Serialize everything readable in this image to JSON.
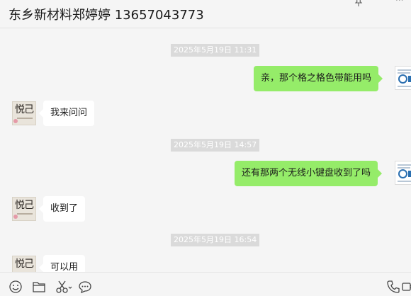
{
  "chat": {
    "title": "东乡新材料郑婷婷 13657043773"
  },
  "header_icons": {
    "pin": "pin-icon",
    "more": "more-icon"
  },
  "messages": [
    {
      "type": "time",
      "text": "2025年5月19日 11:31"
    },
    {
      "type": "sent",
      "text": "亲，那个格之格色带能用吗"
    },
    {
      "type": "received",
      "text": "我来问问"
    },
    {
      "type": "time",
      "text": "2025年5月19日 14:57"
    },
    {
      "type": "sent",
      "text": "还有那两个无线小键盘收到了吗"
    },
    {
      "type": "received",
      "text": "收到了"
    },
    {
      "type": "time",
      "text": "2025年5月19日 16:54"
    },
    {
      "type": "received",
      "text": "可以用"
    }
  ],
  "toolbar": {
    "icons": [
      "emoji-icon",
      "folder-icon",
      "scissors-icon",
      "chat-bubble-icon",
      "phone-icon",
      "video-call-icon"
    ]
  }
}
